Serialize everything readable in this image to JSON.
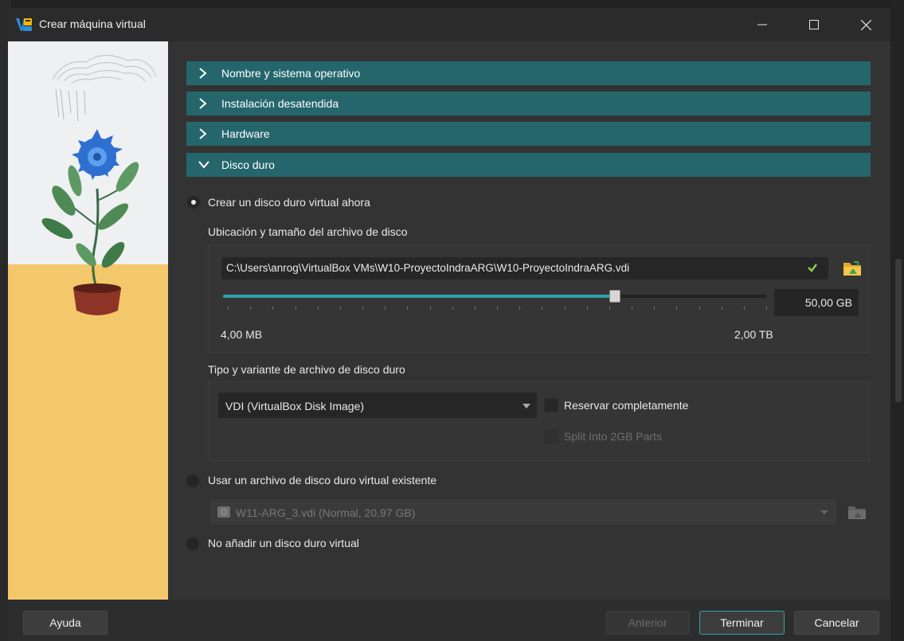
{
  "window": {
    "title": "Crear máquina virtual",
    "controls": [
      "minimize",
      "maximize",
      "close"
    ]
  },
  "sections": [
    {
      "label": "Nombre y sistema operativo",
      "state": "collapsed"
    },
    {
      "label": "Instalación desatendida",
      "state": "collapsed"
    },
    {
      "label": "Hardware",
      "state": "collapsed"
    },
    {
      "label": "Disco duro",
      "state": "expanded"
    }
  ],
  "disk": {
    "option_create": "Crear un disco duro virtual ahora",
    "location_label": "Ubicación y tamaño del archivo de disco",
    "path_value": "C:\\Users\\anrog\\VirtualBox VMs\\W10-ProyectoIndraARG\\W10-ProyectoIndraARG.vdi",
    "size_value": "50,00 GB",
    "size_fraction": 0.72,
    "size_min": "4,00 MB",
    "size_max": "2,00 TB",
    "type_label": "Tipo y variante de archivo de disco duro",
    "type_value": "VDI (VirtualBox Disk Image)",
    "preallocate_label": "Reservar completamente",
    "split_label": "Split Into 2GB Parts",
    "option_existing": "Usar un archivo de disco duro virtual existente",
    "existing_value": "W11-ARG_3.vdi (Normal, 20,97 GB)",
    "option_none": "No añadir un disco duro virtual"
  },
  "footer": {
    "help": "Ayuda",
    "back": "Anterior",
    "finish": "Terminar",
    "cancel": "Cancelar"
  },
  "colors": {
    "section_header": "#25666d",
    "accent": "#2fa3a8",
    "window_bg": "#333333",
    "titlebar_bg": "#2b2b2b"
  },
  "icons": [
    "virtualbox-icon",
    "chevron-right-icon",
    "chevron-down-icon",
    "checkmark-icon",
    "folder-icon",
    "disk-icon",
    "dropdown-arrow-icon"
  ]
}
